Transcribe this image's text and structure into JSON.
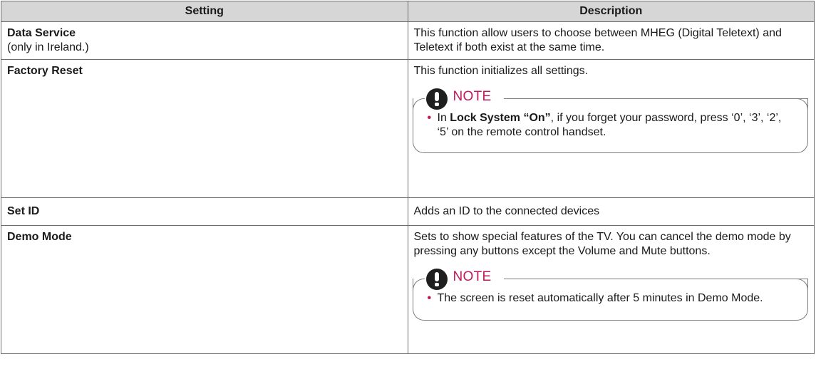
{
  "table": {
    "headers": {
      "setting": "Setting",
      "description": "Description"
    },
    "rows": [
      {
        "name": "Data Service",
        "sub": "(only in Ireland.)",
        "description": "This function allow users to choose between MHEG (Digital Teletext) and Teletext if both exist at the same time."
      },
      {
        "name": "Factory Reset",
        "description": "This function initializes all settings.",
        "note": {
          "title": "NOTE",
          "item_prefix": "In ",
          "item_bold": "Lock System “On”",
          "item_suffix": ", if you forget your password, press ‘0’, ‘3’, ‘2’, ‘5’ on the remote control handset."
        }
      },
      {
        "name": "Set ID",
        "description": "Adds an ID to the connected devices"
      },
      {
        "name": "Demo Mode",
        "description": "Sets to show special features of the TV. You can cancel the demo mode by pressing any buttons except the Volume and Mute buttons.",
        "note": {
          "title": "NOTE",
          "item": "The screen is reset automatically after 5 minutes in Demo Mode."
        }
      }
    ]
  },
  "colors": {
    "header_bg": "#d6d6d6",
    "note_accent": "#c2185b",
    "border": "#6d6d6d"
  },
  "icons": {
    "note": "exclamation-icon",
    "bullet": "bullet-icon"
  }
}
